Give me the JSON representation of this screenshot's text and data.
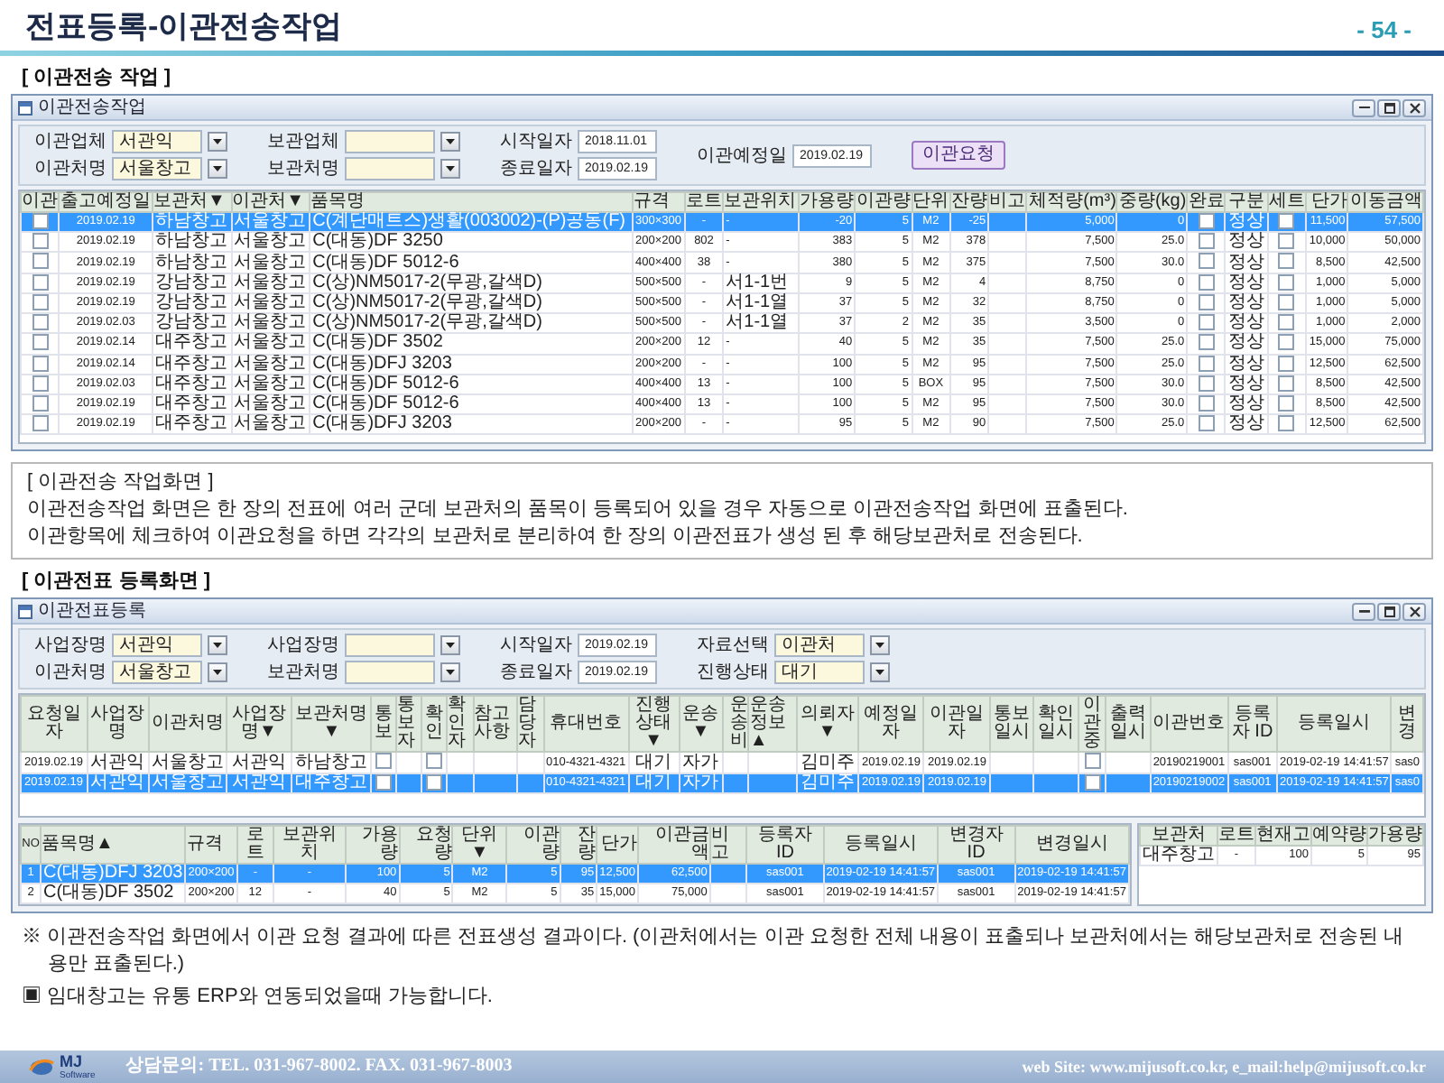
{
  "page": {
    "title": "전표등록-이관전송작업",
    "page_number": "- 54 -"
  },
  "sections": [
    {
      "heading": "[ 이관전송 작업 ]",
      "window": {
        "title": "이관전송작업",
        "filters": [
          [
            {
              "label": "이관업체",
              "kind": "select",
              "value": "서관익"
            },
            {
              "label": "이관처명",
              "kind": "select",
              "value": "서울창고"
            }
          ],
          [
            {
              "label": "보관업체",
              "kind": "select"
            },
            {
              "label": "보관처명",
              "kind": "select"
            }
          ],
          [
            {
              "label": "시작일자",
              "kind": "date",
              "value": "2018.11.01"
            },
            {
              "label": "종료일자",
              "kind": "date",
              "value": "2019.02.19"
            }
          ],
          [
            {
              "label": "이관예정일",
              "kind": "date",
              "value": "2019.02.19"
            }
          ]
        ],
        "button": "이관요청",
        "table": {
          "columns": [
            {
              "label": "이관",
              "kind": "check"
            },
            {
              "label": "출고예정일",
              "kind": "center"
            },
            {
              "label": "보관처▼",
              "kind": "text"
            },
            {
              "label": "이관처▼",
              "kind": "text"
            },
            {
              "label": "품목명",
              "kind": "text"
            },
            {
              "label": "규격",
              "kind": "text"
            },
            {
              "label": "로트",
              "kind": "center"
            },
            {
              "label": "보관위치",
              "kind": "text"
            },
            {
              "label": "가용량",
              "kind": "number"
            },
            {
              "label": "이관량",
              "kind": "number"
            },
            {
              "label": "단위",
              "kind": "center"
            },
            {
              "label": "잔량",
              "kind": "number"
            },
            {
              "label": "비고",
              "kind": "text"
            },
            {
              "label": "체적량(m³)",
              "kind": "number"
            },
            {
              "label": "중량(kg)",
              "kind": "number"
            },
            {
              "label": "완료",
              "kind": "check"
            },
            {
              "label": "구분",
              "kind": "center"
            },
            {
              "label": "세트",
              "kind": "check"
            },
            {
              "label": "단가",
              "kind": "number"
            },
            {
              "label": "이동금액",
              "kind": "number"
            }
          ],
          "rows": [
            {
              "selected": true,
              "cells": [
                {
                  "checked": false
                },
                "2019.02.19",
                "하남창고",
                "서울창고",
                "C(계단매트스)생활(003002)-(P)공동(F)",
                "300×300",
                "-",
                "-",
                "-20",
                "5",
                "M2",
                "-25",
                null,
                "5,000",
                "0",
                {
                  "checked": false
                },
                "정상",
                {
                  "checked": false
                },
                "11,500",
                "57,500"
              ]
            },
            {
              "selected": false,
              "cells": [
                {
                  "checked": false
                },
                "2019.02.19",
                "하남창고",
                "서울창고",
                "C(대동)DF 3250",
                "200×200",
                "802",
                "-",
                "383",
                "5",
                "M2",
                "378",
                null,
                "7,500",
                "25.0",
                {
                  "checked": false
                },
                "정상",
                {
                  "checked": false
                },
                "10,000",
                "50,000"
              ]
            },
            {
              "selected": false,
              "cells": [
                {
                  "checked": false
                },
                "2019.02.19",
                "하남창고",
                "서울창고",
                "C(대동)DF 5012-6",
                "400×400",
                "38",
                "-",
                "380",
                "5",
                "M2",
                "375",
                null,
                "7,500",
                "30.0",
                {
                  "checked": false
                },
                "정상",
                {
                  "checked": false
                },
                "8,500",
                "42,500"
              ]
            },
            {
              "selected": false,
              "cells": [
                {
                  "checked": false
                },
                "2019.02.19",
                "강남창고",
                "서울창고",
                "C(상)NM5017-2(무광,갈색D)",
                "500×500",
                "-",
                "서1-1번",
                "9",
                "5",
                "M2",
                "4",
                null,
                "8,750",
                "0",
                {
                  "checked": false
                },
                "정상",
                {
                  "checked": false
                },
                "1,000",
                "5,000"
              ]
            },
            {
              "selected": false,
              "cells": [
                {
                  "checked": false
                },
                "2019.02.19",
                "강남창고",
                "서울창고",
                "C(상)NM5017-2(무광,갈색D)",
                "500×500",
                "-",
                "서1-1열",
                "37",
                "5",
                "M2",
                "32",
                null,
                "8,750",
                "0",
                {
                  "checked": false
                },
                "정상",
                {
                  "checked": false
                },
                "1,000",
                "5,000"
              ]
            },
            {
              "selected": false,
              "cells": [
                {
                  "checked": false
                },
                "2019.02.03",
                "강남창고",
                "서울창고",
                "C(상)NM5017-2(무광,갈색D)",
                "500×500",
                "-",
                "서1-1열",
                "37",
                "2",
                "M2",
                "35",
                null,
                "3,500",
                "0",
                {
                  "checked": false
                },
                "정상",
                {
                  "checked": false
                },
                "1,000",
                "2,000"
              ]
            },
            {
              "selected": false,
              "cells": [
                {
                  "checked": false
                },
                "2019.02.14",
                "대주창고",
                "서울창고",
                "C(대동)DF 3502",
                "200×200",
                "12",
                "-",
                "40",
                "5",
                "M2",
                "35",
                null,
                "7,500",
                "25.0",
                {
                  "checked": false
                },
                "정상",
                {
                  "checked": false
                },
                "15,000",
                "75,000"
              ]
            },
            {
              "selected": false,
              "cells": [
                {
                  "checked": false
                },
                "2019.02.14",
                "대주창고",
                "서울창고",
                "C(대동)DFJ 3203",
                "200×200",
                "-",
                "-",
                "100",
                "5",
                "M2",
                "95",
                null,
                "7,500",
                "25.0",
                {
                  "checked": false
                },
                "정상",
                {
                  "checked": false
                },
                "12,500",
                "62,500"
              ]
            },
            {
              "selected": false,
              "cells": [
                {
                  "checked": false
                },
                "2019.02.03",
                "대주창고",
                "서울창고",
                "C(대동)DF 5012-6",
                "400×400",
                "13",
                "-",
                "100",
                "5",
                "BOX",
                "95",
                null,
                "7,500",
                "30.0",
                {
                  "checked": false
                },
                "정상",
                {
                  "checked": false
                },
                "8,500",
                "42,500"
              ]
            },
            {
              "selected": false,
              "cells": [
                {
                  "checked": false
                },
                "2019.02.19",
                "대주창고",
                "서울창고",
                "C(대동)DF 5012-6",
                "400×400",
                "13",
                "-",
                "100",
                "5",
                "M2",
                "95",
                null,
                "7,500",
                "30.0",
                {
                  "checked": false
                },
                "정상",
                {
                  "checked": false
                },
                "8,500",
                "42,500"
              ]
            },
            {
              "selected": false,
              "cells": [
                {
                  "checked": false
                },
                "2019.02.19",
                "대주창고",
                "서울창고",
                "C(대동)DFJ 3203",
                "200×200",
                "-",
                "-",
                "95",
                "5",
                "M2",
                "90",
                null,
                "7,500",
                "25.0",
                {
                  "checked": false
                },
                "정상",
                {
                  "checked": false
                },
                "12,500",
                "62,500"
              ]
            }
          ]
        }
      },
      "caption": {
        "heading": "[ 이관전송 작업화면 ]",
        "lines": [
          "이관전송작업 화면은 한 장의 전표에 여러 군데 보관처의 품목이 등록되어 있을 경우 자동으로 이관전송작업 화면에 표출된다.",
          "이관항목에 체크하여 이관요청을 하면 각각의 보관처로 분리하여 한 장의 이관전표가 생성 된 후 해당보관처로 전송된다."
        ]
      }
    },
    {
      "heading": "[ 이관전표 등록화면 ]",
      "window": {
        "title": "이관전표등록",
        "filters": [
          [
            {
              "label": "사업장명",
              "kind": "select",
              "value": "서관익"
            },
            {
              "label": "이관처명",
              "kind": "select",
              "value": "서울창고"
            }
          ],
          [
            {
              "label": "사업장명",
              "kind": "select"
            },
            {
              "label": "보관처명",
              "kind": "select"
            }
          ],
          [
            {
              "label": "시작일자",
              "kind": "date",
              "value": "2019.02.19"
            },
            {
              "label": "종료일자",
              "kind": "date",
              "value": "2019.02.19"
            }
          ],
          [
            {
              "label": "자료선택",
              "kind": "select",
              "value": "이관처"
            },
            {
              "label": "진행상태",
              "kind": "select",
              "value": "대기"
            }
          ]
        ],
        "table": {
          "columns": [
            {
              "label": "요청일자",
              "kind": "center"
            },
            {
              "label": "사업장명",
              "kind": "center"
            },
            {
              "label": "이관처명",
              "kind": "center"
            },
            {
              "label": "사업장명▼",
              "kind": "center"
            },
            {
              "label": "보관처명▼",
              "kind": "center"
            },
            {
              "label": "통보",
              "kind": "check"
            },
            {
              "label": "통보자",
              "kind": "text"
            },
            {
              "label": "확인",
              "kind": "check"
            },
            {
              "label": "확인자",
              "kind": "text"
            },
            {
              "label": "참고사항",
              "kind": "text"
            },
            {
              "label": "담당자",
              "kind": "text"
            },
            {
              "label": "휴대번호",
              "kind": "center"
            },
            {
              "label": "진행상태▼",
              "kind": "center"
            },
            {
              "label": "운송▼",
              "kind": "center"
            },
            {
              "label": "운송비",
              "kind": "number"
            },
            {
              "label": "운송정보▲",
              "kind": "text"
            },
            {
              "label": "의뢰자▼",
              "kind": "center"
            },
            {
              "label": "예정일자",
              "kind": "center"
            },
            {
              "label": "이관일자",
              "kind": "center"
            },
            {
              "label": "통보일시",
              "kind": "center"
            },
            {
              "label": "확인일시",
              "kind": "center"
            },
            {
              "label": "이관중",
              "kind": "check"
            },
            {
              "label": "출력일시",
              "kind": "center"
            },
            {
              "label": "이관번호",
              "kind": "center"
            },
            {
              "label": "등록자 ID",
              "kind": "center"
            },
            {
              "label": "등록일시",
              "kind": "center"
            },
            {
              "label": "변경",
              "kind": "center"
            }
          ],
          "rows": [
            {
              "selected": false,
              "cells": [
                "2019.02.19",
                "서관익",
                "서울창고",
                "서관익",
                "하남창고",
                {
                  "checked": false
                },
                null,
                {
                  "checked": false
                },
                null,
                null,
                null,
                "010-4321-4321",
                "대기",
                "자가",
                null,
                null,
                "김미주",
                "2019.02.19",
                "2019.02.19",
                null,
                null,
                {
                  "checked": false
                },
                null,
                "20190219001",
                "sas001",
                "2019-02-19 14:41:57",
                "sas0"
              ]
            },
            {
              "selected": true,
              "cells": [
                "2019.02.19",
                "서관익",
                "서울창고",
                "서관익",
                "대주창고",
                {
                  "checked": false
                },
                null,
                {
                  "checked": false
                },
                null,
                null,
                null,
                "010-4321-4321",
                "대기",
                "자가",
                null,
                null,
                "김미주",
                "2019.02.19",
                "2019.02.19",
                null,
                null,
                {
                  "checked": false
                },
                null,
                "20190219002",
                "sas001",
                "2019-02-19 14:41:57",
                "sas0"
              ]
            }
          ]
        },
        "lower_tables": [
          {
            "columns": [
              {
                "label": "NO",
                "kind": "center"
              },
              {
                "label": "품목명▲",
                "kind": "text"
              },
              {
                "label": "규격",
                "kind": "text"
              },
              {
                "label": "로트",
                "kind": "center"
              },
              {
                "label": "보관위치",
                "kind": "center"
              },
              {
                "label": "가용량",
                "kind": "number"
              },
              {
                "label": "요청량",
                "kind": "number"
              },
              {
                "label": "단위▼",
                "kind": "center"
              },
              {
                "label": "이관량",
                "kind": "number"
              },
              {
                "label": "잔량",
                "kind": "number"
              },
              {
                "label": "단가",
                "kind": "number"
              },
              {
                "label": "이관금액",
                "kind": "number"
              },
              {
                "label": "비고",
                "kind": "text"
              },
              {
                "label": "등록자 ID",
                "kind": "center"
              },
              {
                "label": "등록일시",
                "kind": "center"
              },
              {
                "label": "변경자 ID",
                "kind": "center"
              },
              {
                "label": "변경일시",
                "kind": "center"
              }
            ],
            "rows": [
              {
                "selected": true,
                "cells": [
                  "1",
                  "C(대동)DFJ 3203",
                  "200×200",
                  "-",
                  "-",
                  "100",
                  "5",
                  "M2",
                  "5",
                  "95",
                  "12,500",
                  "62,500",
                  null,
                  "sas001",
                  "2019-02-19 14:41:57",
                  "sas001",
                  "2019-02-19 14:41:57"
                ]
              },
              {
                "selected": false,
                "cells": [
                  "2",
                  "C(대동)DF 3502",
                  "200×200",
                  "12",
                  "-",
                  "40",
                  "5",
                  "M2",
                  "5",
                  "35",
                  "15,000",
                  "75,000",
                  null,
                  "sas001",
                  "2019-02-19 14:41:57",
                  "sas001",
                  "2019-02-19 14:41:57"
                ]
              }
            ]
          },
          {
            "columns": [
              {
                "label": "보관처",
                "kind": "center"
              },
              {
                "label": "로트",
                "kind": "center"
              },
              {
                "label": "현재고",
                "kind": "number"
              },
              {
                "label": "예약량",
                "kind": "number"
              },
              {
                "label": "가용량",
                "kind": "number"
              }
            ],
            "rows": [
              {
                "selected": false,
                "cells": [
                  "대주창고",
                  "-",
                  "100",
                  "5",
                  "95"
                ]
              }
            ]
          }
        ]
      }
    }
  ],
  "notes": [
    "※ 이관전송작업 화면에서 이관 요청 결과에 따른 전표생성 결과이다. (이관처에서는 이관 요청한 전체 내용이 표출되나 보관처에서는 해당보관처로 전송된 내용만 표출된다.)",
    "▣ 임대창고는 유통 ERP와 연동되었을때 가능합니다."
  ],
  "footer": {
    "logo_mark": "MJ",
    "logo_text": "Software",
    "contact": "상담문의: TEL. 031-967-8002. FAX. 031-967-8003",
    "web": "web Site: www.mijusoft.co.kr, e_mail:help@mijusoft.co.kr"
  }
}
